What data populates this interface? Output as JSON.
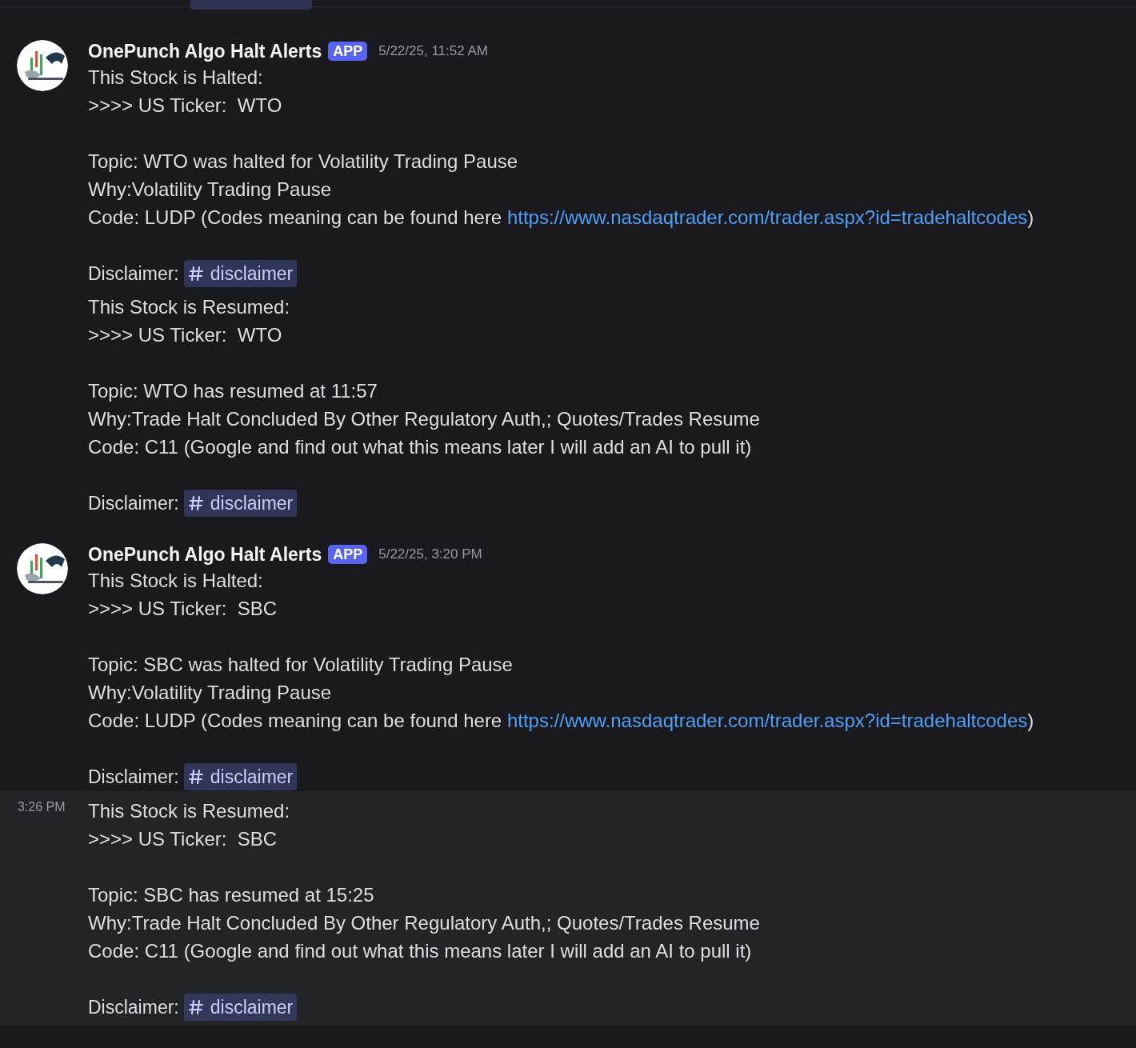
{
  "groups": [
    {
      "author": "OnePunch Algo Halt Alerts",
      "badge": "APP",
      "timestamp": "5/22/25, 11:52 AM",
      "messages": [
        {
          "hovered": false,
          "paragraphs": [
            [
              {
                "text": "This Stock is Halted:"
              },
              {
                "text": ">>>> US Ticker:  WTO"
              }
            ],
            [
              {
                "text": "Topic: WTO was halted for Volatility Trading Pause"
              },
              {
                "text": "Why:Volatility Trading Pause"
              },
              {
                "text": "Code: LUDP (Codes meaning can be found here ",
                "link": "https://www.nasdaqtrader.com/trader.aspx?id=tradehaltcodes",
                "after": ")"
              }
            ]
          ],
          "disclaimer": {
            "label": "Disclaimer:",
            "channel": "disclaimer"
          }
        },
        {
          "hovered": false,
          "paragraphs": [
            [
              {
                "text": "This Stock is Resumed:"
              },
              {
                "text": ">>>> US Ticker:  WTO"
              }
            ],
            [
              {
                "text": "Topic: WTO has resumed at 11:57"
              },
              {
                "text": "Why:Trade Halt Concluded By Other Regulatory Auth,; Quotes/Trades Resume"
              },
              {
                "text": "Code: C11 (Google and find out what this means later I will add an AI to pull it)"
              }
            ]
          ],
          "disclaimer": {
            "label": "Disclaimer:",
            "channel": "disclaimer"
          }
        }
      ]
    },
    {
      "author": "OnePunch Algo Halt Alerts",
      "badge": "APP",
      "timestamp": "5/22/25, 3:20 PM",
      "messages": [
        {
          "hovered": false,
          "paragraphs": [
            [
              {
                "text": "This Stock is Halted:"
              },
              {
                "text": ">>>> US Ticker:  SBC"
              }
            ],
            [
              {
                "text": "Topic: SBC was halted for Volatility Trading Pause"
              },
              {
                "text": "Why:Volatility Trading Pause"
              },
              {
                "text": "Code: LUDP (Codes meaning can be found here ",
                "link": "https://www.nasdaqtrader.com/trader.aspx?id=tradehaltcodes",
                "after": ")"
              }
            ]
          ],
          "disclaimer": {
            "label": "Disclaimer:",
            "channel": "disclaimer"
          }
        },
        {
          "hovered": true,
          "time": "3:26 PM",
          "paragraphs": [
            [
              {
                "text": "This Stock is Resumed:"
              },
              {
                "text": ">>>> US Ticker:  SBC"
              }
            ],
            [
              {
                "text": "Topic: SBC has resumed at 15:25"
              },
              {
                "text": "Why:Trade Halt Concluded By Other Regulatory Auth,; Quotes/Trades Resume"
              },
              {
                "text": "Code: C11 (Google and find out what this means later I will add an AI to pull it)"
              }
            ]
          ],
          "disclaimer": {
            "label": "Disclaimer:",
            "channel": "disclaimer"
          }
        }
      ]
    }
  ]
}
